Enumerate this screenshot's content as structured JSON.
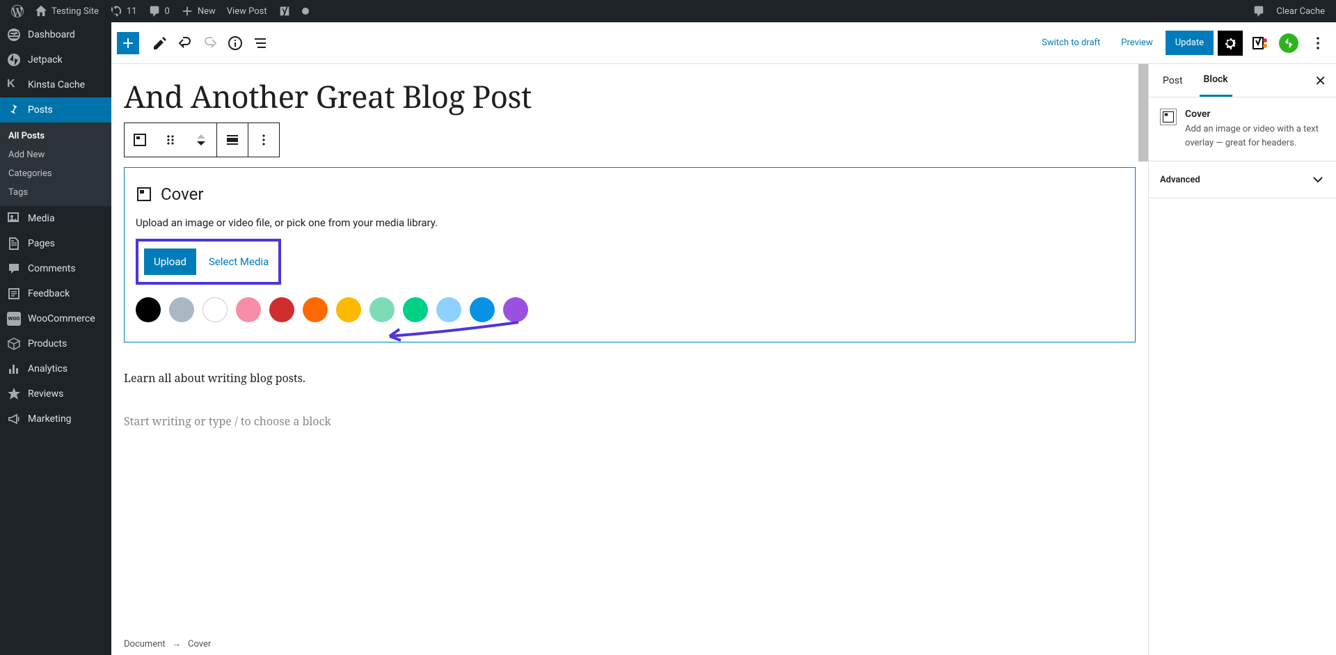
{
  "adminbar": {
    "site_name": "Testing Site",
    "updates": "11",
    "comments": "0",
    "new": "New",
    "view_post": "View Post",
    "clear_cache": "Clear Cache"
  },
  "leftnav": {
    "dashboard": "Dashboard",
    "jetpack": "Jetpack",
    "kinsta_cache": "Kinsta Cache",
    "posts": "Posts",
    "media": "Media",
    "pages": "Pages",
    "comments": "Comments",
    "feedback": "Feedback",
    "woocommerce": "WooCommerce",
    "products": "Products",
    "analytics": "Analytics",
    "reviews": "Reviews",
    "marketing": "Marketing",
    "sub": {
      "all_posts": "All Posts",
      "add_new": "Add New",
      "categories": "Categories",
      "tags": "Tags"
    }
  },
  "editor": {
    "switch_to_draft": "Switch to draft",
    "preview": "Preview",
    "update": "Update",
    "post_title": "And Another Great Blog Post"
  },
  "cover": {
    "heading": "Cover",
    "description": "Upload an image or video file, or pick one from your media library.",
    "upload": "Upload",
    "select_media": "Select Media",
    "colors": [
      "#000000",
      "#abb8c3",
      "#ffffff",
      "#f78da7",
      "#cf2e2e",
      "#ff6900",
      "#fcb900",
      "#7bdcb5",
      "#00d084",
      "#8ed1fc",
      "#0693e3",
      "#9b51e0"
    ]
  },
  "content": {
    "paragraph": "Learn all about writing blog posts.",
    "placeholder": "Start writing or type / to choose a block"
  },
  "breadcrumb": {
    "document": "Document",
    "arrow": "→",
    "current": "Cover"
  },
  "rsidebar": {
    "tab_post": "Post",
    "tab_block": "Block",
    "block_name": "Cover",
    "block_desc": "Add an image or video with a text overlay — great for headers.",
    "advanced": "Advanced"
  }
}
